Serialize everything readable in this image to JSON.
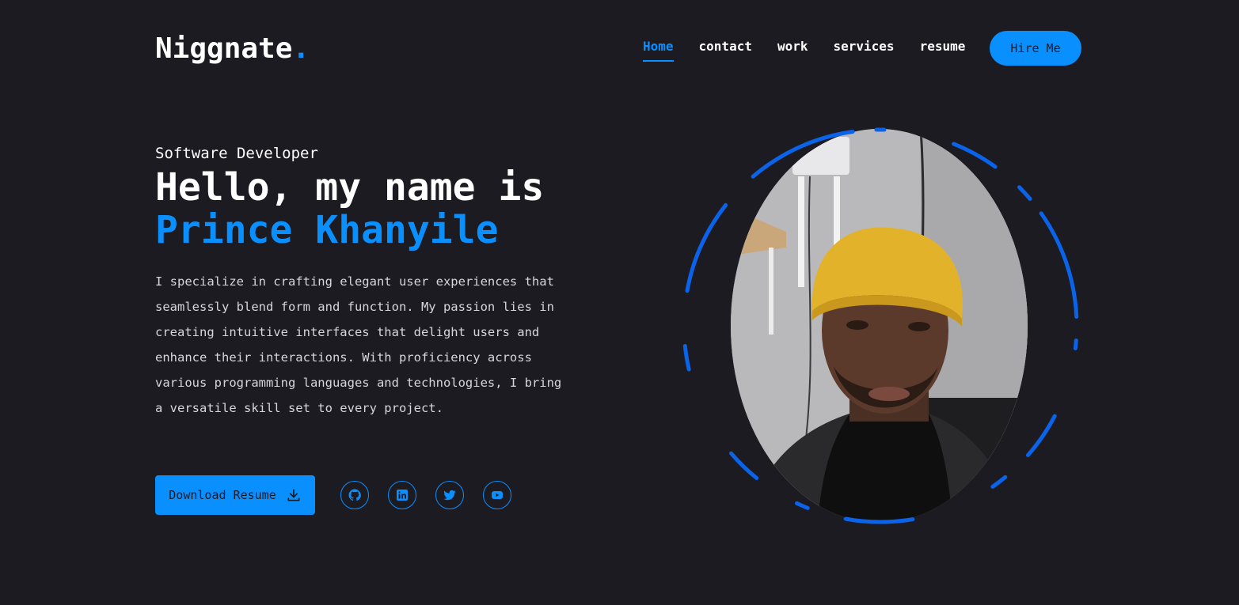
{
  "header": {
    "logo_text": "Niggnate",
    "logo_dot": ".",
    "nav": [
      {
        "label": "Home",
        "active": true
      },
      {
        "label": "contact",
        "active": false
      },
      {
        "label": "work",
        "active": false
      },
      {
        "label": "services",
        "active": false
      },
      {
        "label": "resume",
        "active": false
      }
    ],
    "hire_label": "Hire Me"
  },
  "hero": {
    "subtitle": "Software Developer",
    "greeting": "Hello, my name is",
    "name": "Prince Khanyile",
    "bio": "I specialize in crafting elegant user experiences that seamlessly blend form and function. My passion lies in creating intuitive interfaces that delight users and enhance their interactions. With proficiency across various programming languages and technologies, I bring a versatile skill set to every project.",
    "download_label": "Download Resume"
  },
  "socials": [
    {
      "icon": "github-icon"
    },
    {
      "icon": "linkedin-icon"
    },
    {
      "icon": "twitter-icon"
    },
    {
      "icon": "youtube-icon"
    }
  ],
  "colors": {
    "background": "#1c1b22",
    "accent": "#0a8fff",
    "ring": "#0a63e8"
  }
}
